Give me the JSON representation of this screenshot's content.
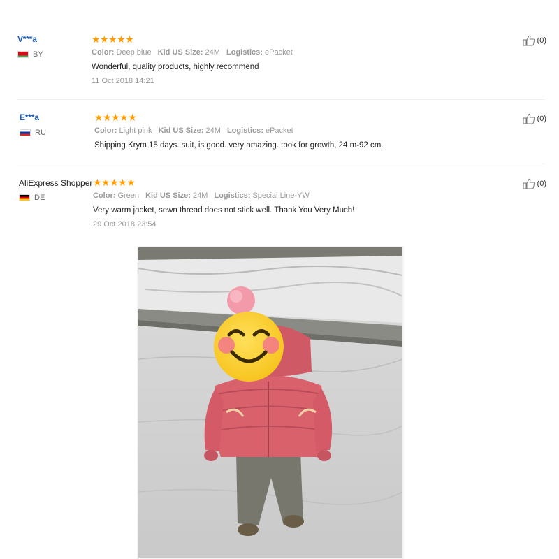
{
  "reviews": [
    {
      "user": "V***a",
      "country": "BY",
      "stars": "★★★★★",
      "color_label": "Color:",
      "color_value": "Deep blue",
      "size_label": "Kid US Size:",
      "size_value": "24M",
      "logistics_label": "Logistics:",
      "logistics_value": "ePacket",
      "feedback": "Wonderful, quality products, highly recommend",
      "date": "11 Oct 2018 14:21",
      "helpful": "(0)"
    },
    {
      "user": "E***a",
      "country": "RU",
      "stars": "★★★★★",
      "color_label": "Color:",
      "color_value": "Light pink",
      "size_label": "Kid US Size:",
      "size_value": "24M",
      "logistics_label": "Logistics:",
      "logistics_value": "ePacket",
      "feedback": "Shipping Krym 15 days. suit, is good. very amazing. took for growth, 24 m-92 cm.",
      "helpful": "(0)"
    },
    {
      "user": "AliExpress Shopper",
      "country": "DE",
      "stars": "★★★★★",
      "color_label": "Color:",
      "color_value": "Green",
      "size_label": "Kid US Size:",
      "size_value": "24M",
      "logistics_label": "Logistics:",
      "logistics_value": "Special Line-YW",
      "feedback": "Very warm jacket, sewn thread does not stick well. Thank You Very Much!",
      "date": "29 Oct 2018 23:54",
      "helpful": "(0)"
    }
  ],
  "colors": {
    "masked_username": "#1c5bb5",
    "star": "#ff9b00",
    "meta_text": "#999999",
    "jacket": "#d9616c"
  },
  "icons": [
    "thumbs-up-icon",
    "flag-icon",
    "star-icon",
    "smiley-face-sticker"
  ]
}
